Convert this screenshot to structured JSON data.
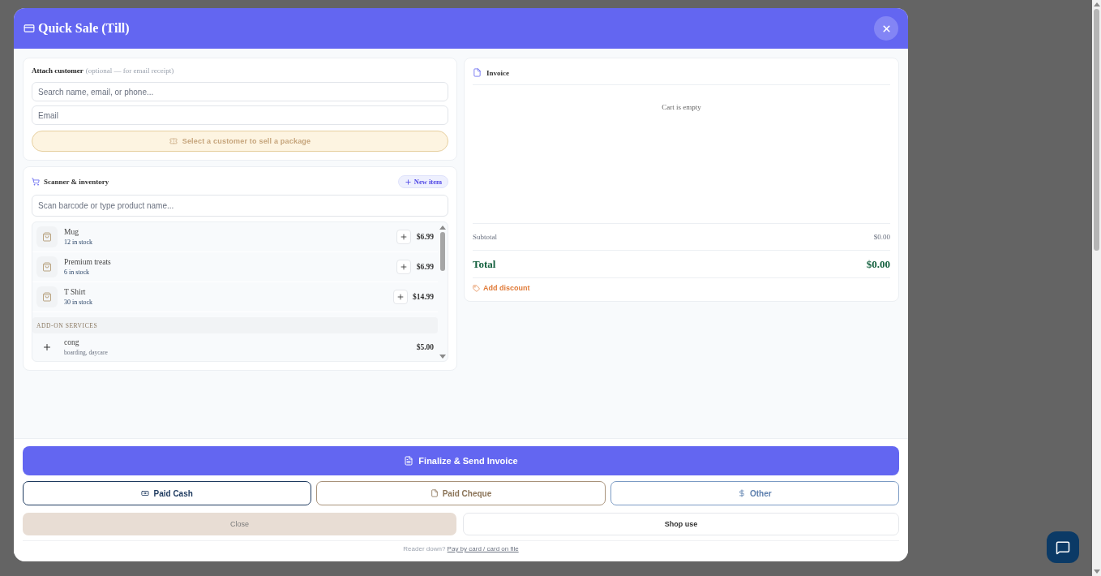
{
  "window": {
    "title": "Quick Sale (Till)"
  },
  "customer": {
    "label": "Attach customer",
    "hint": "(optional — for email receipt)",
    "search": {
      "placeholder": "Search name, email, or phone..."
    },
    "email": {
      "placeholder": "Email"
    },
    "package_button": {
      "label": "Select a customer to sell a package",
      "disabled": true
    }
  },
  "inventory": {
    "title": "Scanner & inventory",
    "new_item_button": "New item",
    "search": {
      "placeholder": "Scan barcode or type product name..."
    },
    "products": [
      {
        "name": "Mug",
        "stock": "12 in stock",
        "price": "$6.99"
      },
      {
        "name": "Premium treats",
        "stock": "6 in stock",
        "price": "$6.99"
      },
      {
        "name": "T Shirt",
        "stock": "30 in stock",
        "price": "$14.99"
      }
    ],
    "section_heading": "ADD-ON SERVICES",
    "services": [
      {
        "name": "cong",
        "detail": "boarding, daycare",
        "price": "$5.00"
      }
    ]
  },
  "invoice": {
    "title": "Invoice",
    "empty_message": "Cart is empty",
    "subtotal": {
      "label": "Subtotal",
      "value": "$0.00"
    },
    "total": {
      "label": "Total",
      "value": "$0.00"
    },
    "discount_link": "Add discount"
  },
  "actions": {
    "finalize": "Finalize & Send Invoice",
    "payments": [
      {
        "kind": "cash",
        "label": "Paid Cash"
      },
      {
        "kind": "cheque",
        "label": "Paid Cheque"
      },
      {
        "kind": "other",
        "label": "Other"
      }
    ],
    "close": "Close",
    "shop_use": "Shop use"
  },
  "footer_note": {
    "text": "Reader down?",
    "link": "Pay by card / card on file"
  }
}
